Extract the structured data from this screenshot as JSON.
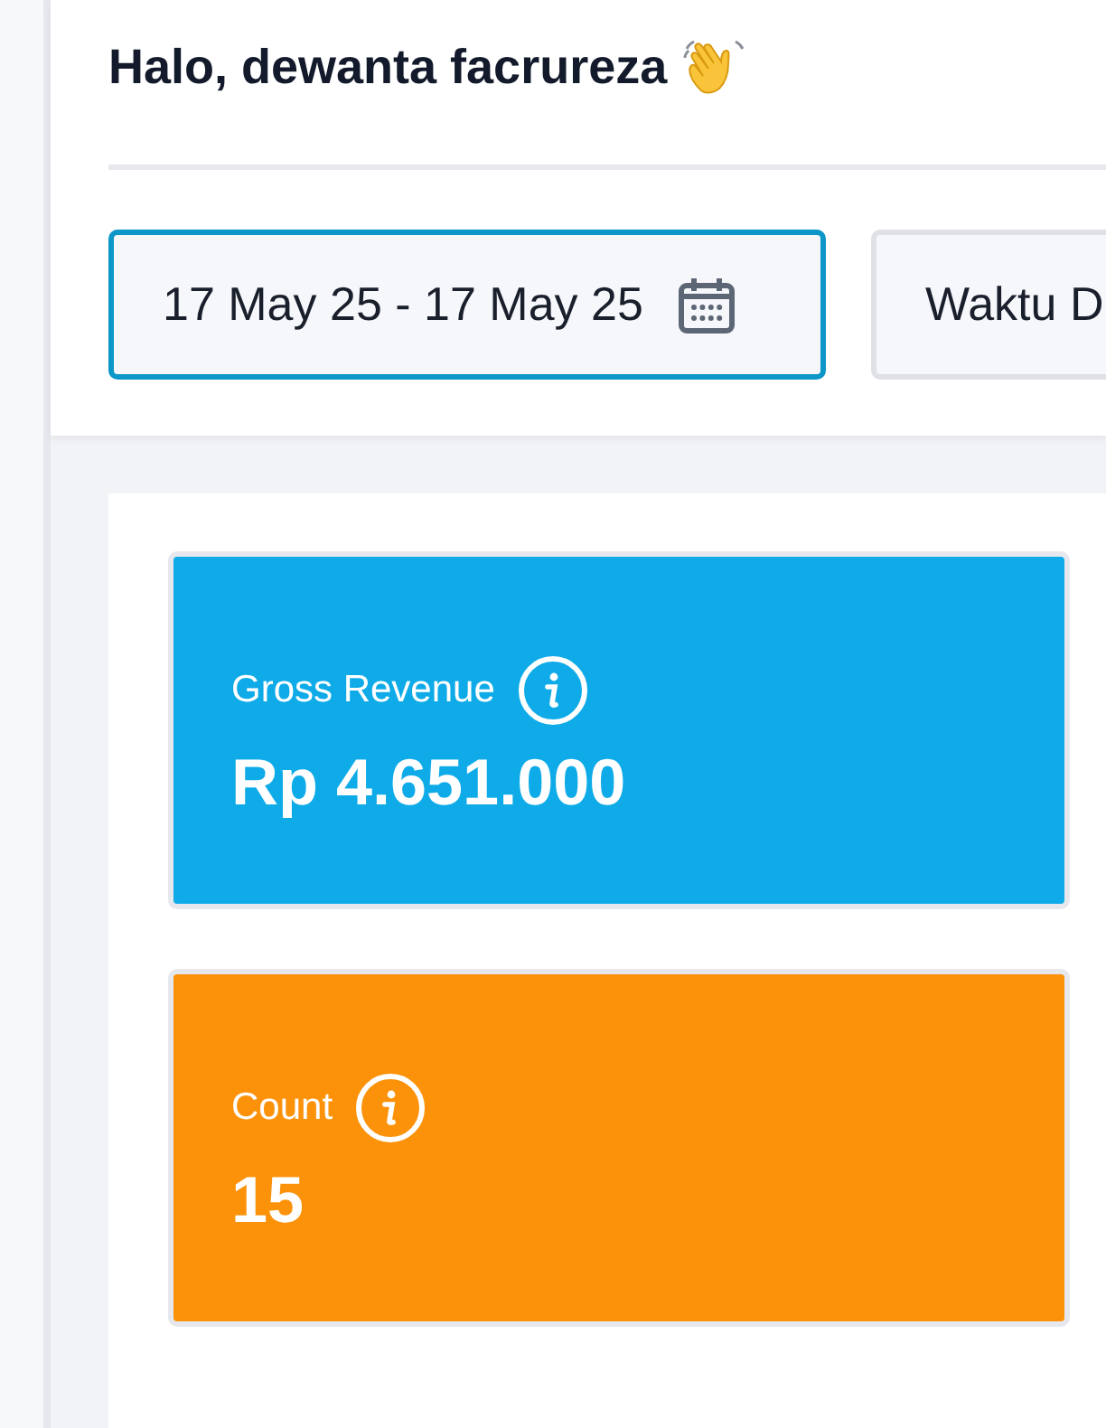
{
  "greeting": "Halo, dewanta facrureza",
  "filters": [
    {
      "kind": "date",
      "value": "17 May 25 - 17 May 25",
      "selected": true
    },
    {
      "kind": "select",
      "value": "Waktu D",
      "selected": false
    }
  ],
  "stats": [
    {
      "label": "Gross Revenue",
      "value": "Rp 4.651.000",
      "color": "#0eabe8"
    },
    {
      "label": "Count",
      "value": "15",
      "color": "#fb920a"
    }
  ]
}
